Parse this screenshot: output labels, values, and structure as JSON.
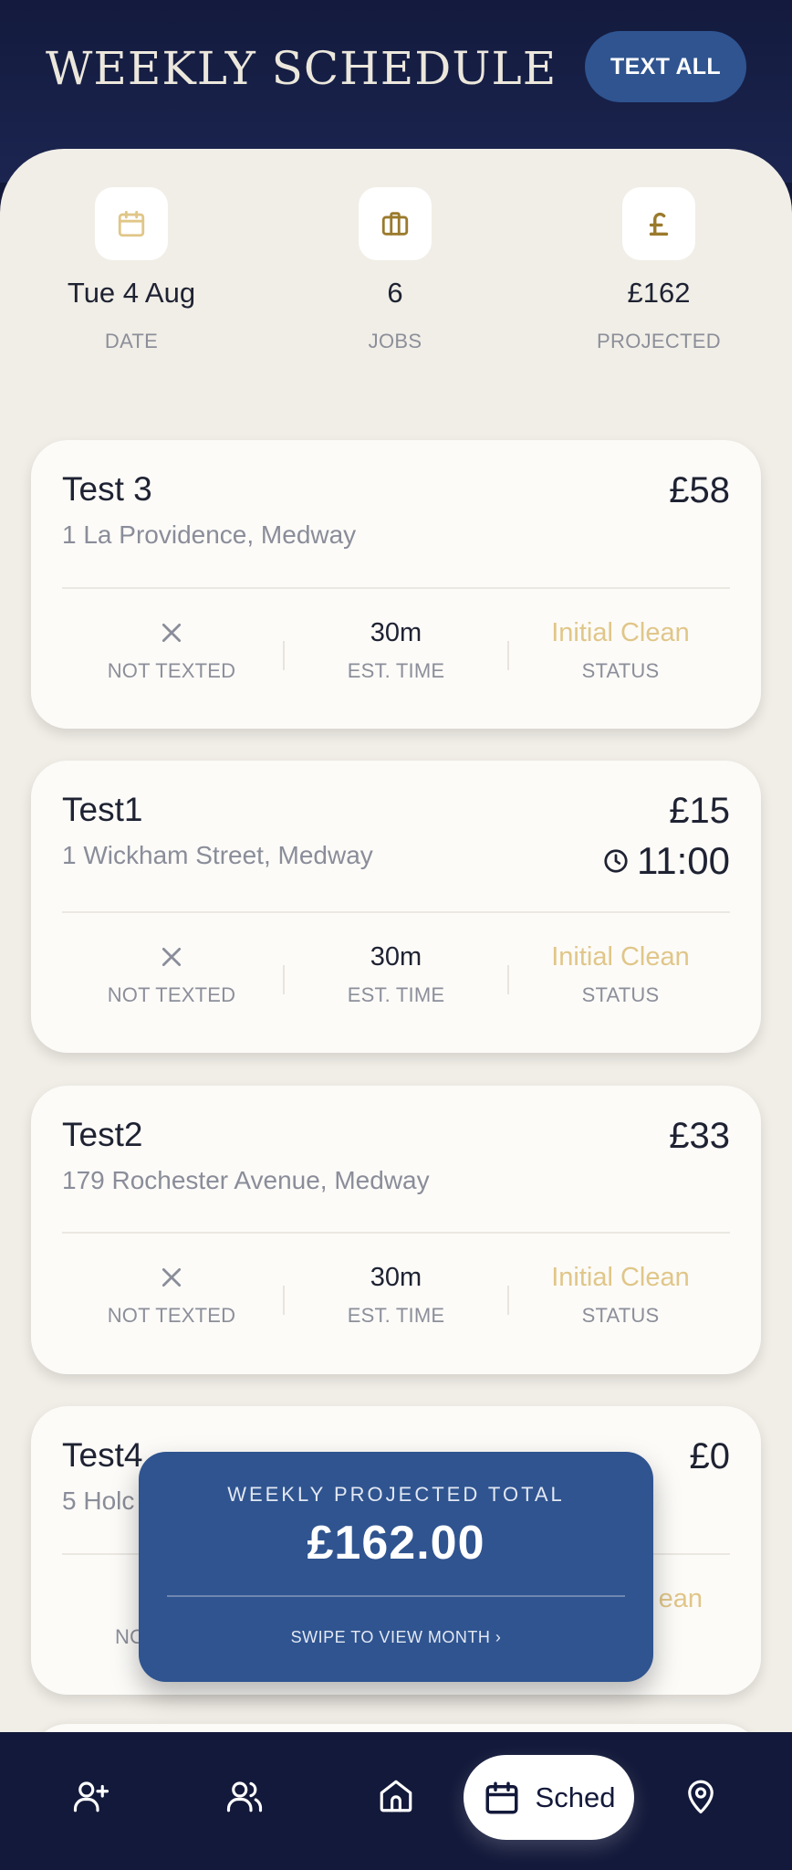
{
  "header": {
    "title": "WEEKLY SCHEDULE",
    "text_all_label": "TEXT ALL"
  },
  "stats": [
    {
      "icon": "calendar-icon",
      "value": "Tue 4 Aug",
      "label": "DATE"
    },
    {
      "icon": "briefcase-icon",
      "value": "6",
      "label": "JOBS"
    },
    {
      "icon": "pound-icon",
      "value": "£162",
      "label": "PROJECTED"
    }
  ],
  "jobs": [
    {
      "name": "Test 3",
      "address": "1 La Providence, Medway",
      "price": "£58",
      "time": "",
      "texted": "NOT TEXTED",
      "est_time": "30m",
      "est_label": "EST. TIME",
      "status": "Initial Clean",
      "status_label": "STATUS"
    },
    {
      "name": "Test1",
      "address": "1 Wickham Street, Medway",
      "price": "£15",
      "time": "11:00",
      "texted": "NOT TEXTED",
      "est_time": "30m",
      "est_label": "EST. TIME",
      "status": "Initial Clean",
      "status_label": "STATUS"
    },
    {
      "name": "Test2",
      "address": "179 Rochester Avenue, Medway",
      "price": "£33",
      "time": "",
      "texted": "NOT TEXTED",
      "est_time": "30m",
      "est_label": "EST. TIME",
      "status": "Initial Clean",
      "status_label": "STATUS"
    },
    {
      "name": "Test4",
      "address": "5 Holc",
      "price": "£0",
      "time": "",
      "texted": "NO",
      "est_time": "",
      "est_label": "",
      "status": "ean",
      "status_label": "S"
    }
  ],
  "popup": {
    "label": "WEEKLY PROJECTED TOTAL",
    "value": "£162.00",
    "footer": "SWIPE TO VIEW MONTH ›"
  },
  "nav": {
    "items": [
      "add-user-icon",
      "users-icon",
      "home-icon",
      "calendar-icon",
      "location-pin-icon"
    ],
    "active_label": "Sched"
  },
  "colors": {
    "navy": "#13193a",
    "accent_blue": "#2f5490",
    "cream": "#f1eee7",
    "gold": "#e0c688",
    "gold_dark": "#9a7a2c"
  }
}
